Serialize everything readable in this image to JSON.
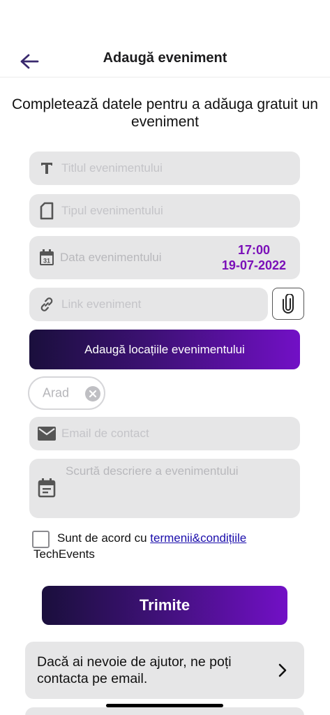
{
  "header": {
    "title": "Adaugă eveniment",
    "back_icon": "arrow-left-icon"
  },
  "subtitle": "Completează datele pentru a adăuga gratuit un eveniment",
  "form": {
    "title_field": {
      "value": "",
      "placeholder": "Titlul evenimentului",
      "icon": "text-icon"
    },
    "type_field": {
      "value": "",
      "placeholder": "Tipul evenimentului",
      "icon": "document-icon"
    },
    "date_field": {
      "placeholder": "Data evenimentului",
      "time": "17:00",
      "date": "19-07-2022",
      "icon": "calendar-icon"
    },
    "link_field": {
      "value": "",
      "placeholder": "Link eveniment",
      "icon": "link-icon",
      "attach_icon": "paperclip-icon"
    },
    "locations_button_label": "Adaugă locațiile evenimentului",
    "location_chips": [
      {
        "label": "Arad"
      }
    ],
    "email_field": {
      "value": "",
      "placeholder": "Email de contact",
      "icon": "mail-icon"
    },
    "description_field": {
      "value": "",
      "placeholder": "Scurtă descriere a evenimentului",
      "icon": "event-note-icon"
    },
    "terms": {
      "prefix": "Sunt de acord cu ",
      "link": "termenii&condițiile",
      "suffix": "TechEvents",
      "checked": false
    },
    "submit_label": "Trimite"
  },
  "help": {
    "text": "Dacă ai nevoie de ajutor, ne poți contacta pe email.",
    "icon": "chevron-right-icon"
  },
  "colors": {
    "accent": "#7a0fb8",
    "gradient_start": "#1a0f3c",
    "gradient_end": "#7210c6",
    "field_bg": "#e6e6e7"
  }
}
